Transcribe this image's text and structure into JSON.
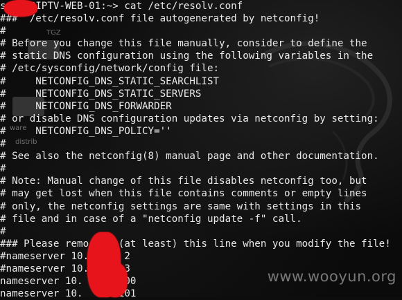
{
  "desktop": {
    "labels": [
      "TGZ",
      "ware",
      "distrib"
    ]
  },
  "terminal": {
    "lines": [
      "s    @IPTV-WEB-01:~> cat /etc/resolv.conf",
      "###  /etc/resolv.conf file autogenerated by netconfig!",
      "#",
      "# Before you change this file manually, consider to define the",
      "# static DNS configuration using the following variables in the",
      "# /etc/sysconfig/network/config file:",
      "#     NETCONFIG_DNS_STATIC_SEARCHLIST",
      "#     NETCONFIG_DNS_STATIC_SERVERS",
      "#     NETCONFIG_DNS_FORWARDER",
      "# or disable DNS configuration updates via netconfig by setting:",
      "#     NETCONFIG_DNS_POLICY=''",
      "#",
      "# See also the netconfig(8) manual page and other documentation.",
      "#",
      "# Note: Manual change of this file disables netconfig too, but",
      "# may get lost when this file contains comments or empty lines",
      "# only, the netconfig settings are same with settings in this",
      "# file and in case of a \"netconfig update -f\" call.",
      "#",
      "### Please remo     (at least) this line when you modify the file!",
      "#nameserver 10.      2",
      "#nameserver 10.      3",
      "nameserver 10.     .100",
      "nameserver 10.     .101"
    ]
  },
  "watermark": "www.wooyun.org",
  "colors": {
    "background": "#0d0d0d",
    "text": "#e9e9e9",
    "redaction": "#e8141c"
  }
}
